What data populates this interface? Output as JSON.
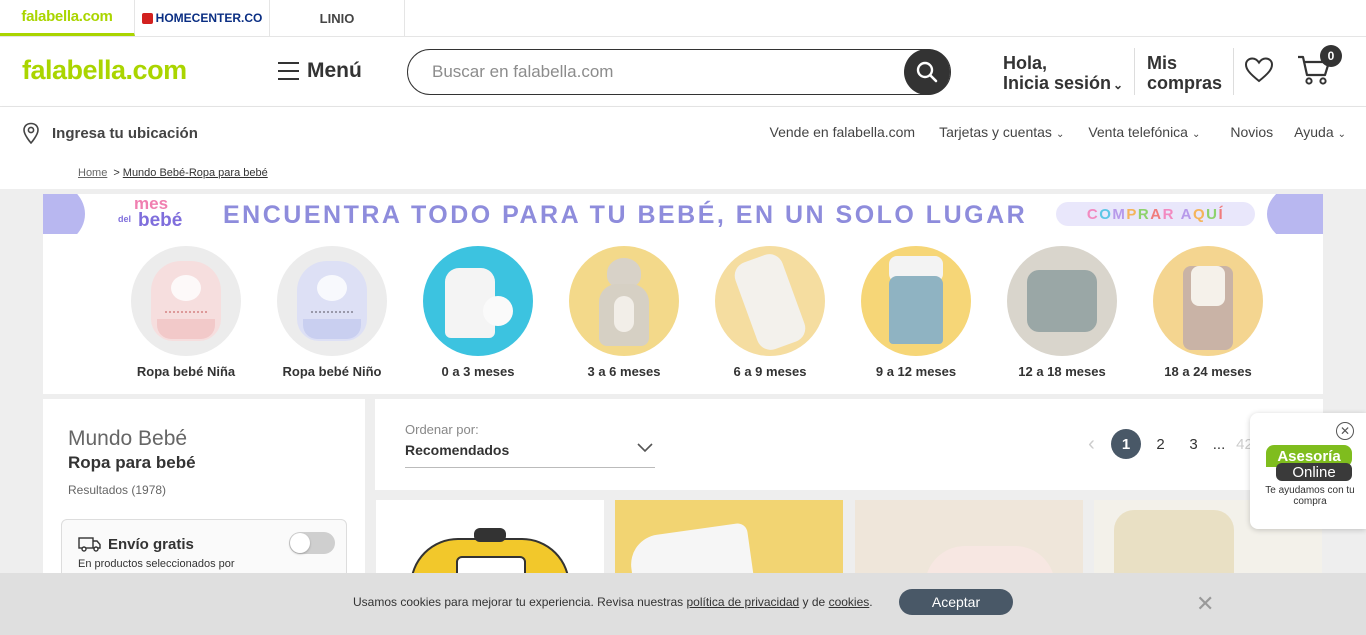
{
  "brands": [
    {
      "label": "falabella.com"
    },
    {
      "label": "HOMECENTER.CO"
    },
    {
      "label": "LINIO"
    }
  ],
  "header": {
    "logo": "falabella.com",
    "menu_label": "Menú",
    "search_placeholder": "Buscar en falabella.com",
    "login_line1": "Hola,",
    "login_line2": "Inicia sesión",
    "purchases_line1": "Mis",
    "purchases_line2": "compras",
    "cart_count": "0"
  },
  "subheader": {
    "location": "Ingresa tu ubicación",
    "nav": [
      {
        "label": "Vende en falabella.com",
        "has_chevron": false
      },
      {
        "label": "Tarjetas y cuentas",
        "has_chevron": true
      },
      {
        "label": "Venta telefónica",
        "has_chevron": true
      },
      {
        "label": "Novios",
        "has_chevron": false
      },
      {
        "label": "Ayuda",
        "has_chevron": true
      }
    ]
  },
  "breadcrumb": {
    "home": "Home",
    "separator": ">",
    "current": "Mundo Bebé-Ropa para bebé"
  },
  "banner": {
    "logo_line1": "mes",
    "logo_line0": "del",
    "logo_line2": "bebé",
    "headline": "ENCUENTRA TODO PARA TU BEBÉ,  EN UN SOLO LUGAR",
    "cta": "COMPRAR AQUÍ"
  },
  "categories": [
    {
      "label": "Ropa bebé Niña"
    },
    {
      "label": "Ropa bebé Niño"
    },
    {
      "label": "0 a 3 meses"
    },
    {
      "label": "3 a 6 meses"
    },
    {
      "label": "6 a 9 meses"
    },
    {
      "label": "9 a 12 meses"
    },
    {
      "label": "12 a 18 meses"
    },
    {
      "label": "18 a 24 meses"
    }
  ],
  "sidebar": {
    "category": "Mundo Bebé",
    "subcategory": "Ropa para bebé",
    "results": "Resultados (1978)",
    "shipping_title": "Envío gratis",
    "shipping_desc": "En productos seleccionados por"
  },
  "toolbar": {
    "sort_label": "Ordenar por:",
    "sort_value": "Recomendados",
    "pages": [
      "1",
      "2",
      "3",
      "...",
      "42"
    ],
    "current_page": "1"
  },
  "chat": {
    "bubble1": "Asesoría",
    "bubble2": "Online",
    "text": "Te ayudamos con tu compra"
  },
  "cookie": {
    "text_before": "Usamos cookies para mejorar tu experiencia. Revisa nuestras ",
    "privacy_link": "política de privacidad",
    "text_middle": " y de ",
    "cookies_link": "cookies",
    "text_after": ".",
    "accept": "Aceptar"
  },
  "colors": {
    "brand_green": "#aad500",
    "dark": "#333333",
    "pager_active": "#495867",
    "banner_purple": "#8e8cdc"
  }
}
